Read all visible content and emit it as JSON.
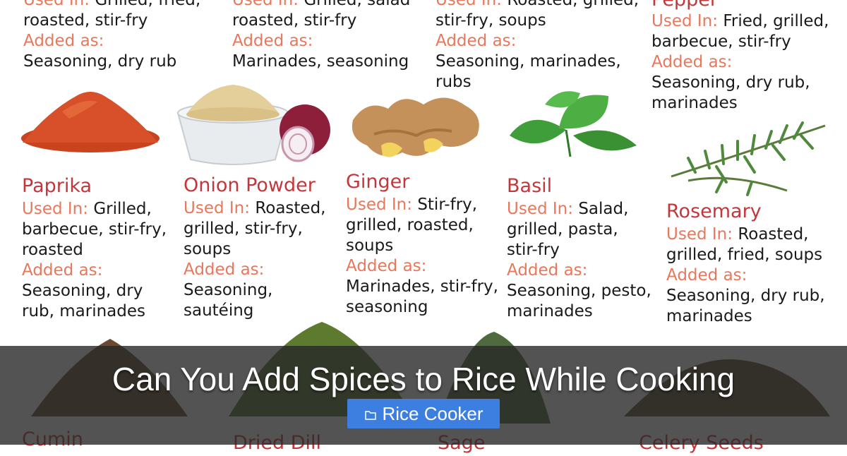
{
  "top_row": [
    {
      "used_in_label": "Used In:",
      "used_in_cont": "Grilled, fried,",
      "lines": [
        "roasted, stir-fry"
      ],
      "added_label": "Added as:",
      "added_lines": [
        "Seasoning, dry rub"
      ]
    },
    {
      "used_in_label": "Used In:",
      "used_in_cont": "Grilled, salad",
      "lines": [
        "roasted, stir-fry"
      ],
      "added_label": "Added as:",
      "added_lines": [
        "Marinades, seasoning"
      ]
    },
    {
      "used_in_label": "Used In:",
      "used_in_cont": "Roasted, grilled,",
      "lines": [
        "stir-fry, soups"
      ],
      "added_label": "Added as:",
      "added_lines": [
        "Seasoning, marinades,",
        "rubs"
      ]
    },
    {
      "name": "Pepper",
      "used_in_label": "Used In:",
      "used_in_lines": [
        "Fried, grilled,",
        "barbecue, stir-fry"
      ],
      "added_label": "Added as:",
      "added_lines": [
        "Seasoning, dry rub,",
        "marinades"
      ]
    }
  ],
  "spices": [
    {
      "name": "Paprika",
      "used_in_label": "Used In:",
      "used_in_lines": [
        "Grilled,",
        "barbecue, stir-fry,",
        "roasted"
      ],
      "added_label": "Added as:",
      "added_lines": [
        "Seasoning, dry",
        "rub, marinades"
      ]
    },
    {
      "name": "Onion Powder",
      "used_in_label": "Used In:",
      "used_in_lines": [
        "Roasted,",
        "grilled, stir-fry,",
        "soups"
      ],
      "added_label": "Added as:",
      "added_lines": [
        "Seasoning,",
        "sautéing"
      ]
    },
    {
      "name": "Ginger",
      "used_in_label": "Used In:",
      "used_in_lines": [
        "Stir-fry,",
        "grilled, roasted,",
        "soups"
      ],
      "added_label": "Added as:",
      "added_lines": [
        "Marinades, stir-fry,",
        "seasoning"
      ]
    },
    {
      "name": "Basil",
      "used_in_label": "Used In:",
      "used_in_lines": [
        "Salad,",
        "grilled, pasta,",
        "stir-fry"
      ],
      "added_label": "Added as:",
      "added_lines": [
        "Seasoning, pesto,",
        "marinades"
      ]
    },
    {
      "name": "Rosemary",
      "used_in_label": "Used In:",
      "used_in_lines": [
        "Roasted,",
        "grilled, fried, soups"
      ],
      "added_label": "Added as:",
      "added_lines": [
        "Seasoning, dry rub,",
        "marinades"
      ]
    }
  ],
  "bottom_names": [
    "Cumin",
    "Dried Dill",
    "Sage",
    "Celery Seeds"
  ],
  "banner": {
    "title": "Can You Add Spices to Rice While Cooking",
    "category": "Rice Cooker",
    "category_icon": "folder-icon"
  },
  "colors": {
    "spice_name": "#c2373b",
    "label": "#e8775b",
    "category_button": "#3d7fe0"
  }
}
